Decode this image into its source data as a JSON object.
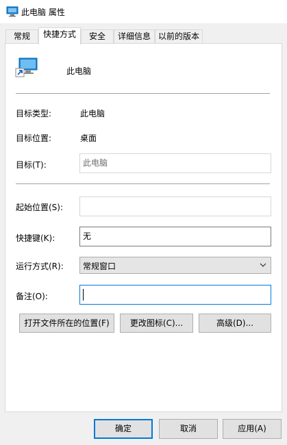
{
  "window": {
    "title": "此电脑 属性",
    "icon": "computer-shortcut-icon"
  },
  "tabs": [
    {
      "label": "常规"
    },
    {
      "label": "快捷方式",
      "active": true
    },
    {
      "label": "安全"
    },
    {
      "label": "详细信息"
    },
    {
      "label": "以前的版本"
    }
  ],
  "shortcut": {
    "name": "此电脑",
    "icon": "computer-shortcut-icon"
  },
  "fields": {
    "target_type": {
      "label": "目标类型:",
      "value": "此电脑"
    },
    "target_location": {
      "label": "目标位置:",
      "value": "桌面"
    },
    "target": {
      "label": "目标(T):",
      "value": "此电脑"
    },
    "start_in": {
      "label": "起始位置(S):",
      "value": ""
    },
    "shortcut_key": {
      "label": "快捷键(K):",
      "value": "无"
    },
    "run": {
      "label": "运行方式(R):",
      "value": "常规窗口"
    },
    "comment": {
      "label": "备注(O):",
      "value": ""
    }
  },
  "buttons": {
    "open_location": "打开文件所在的位置(F)",
    "change_icon": "更改图标(C)...",
    "advanced": "高级(D)..."
  },
  "footer": {
    "ok": "确定",
    "cancel": "取消",
    "apply": "应用(A)"
  },
  "colors": {
    "accent": "#0078d7",
    "background": "#f0f0f0",
    "button": "#e1e1e1"
  }
}
